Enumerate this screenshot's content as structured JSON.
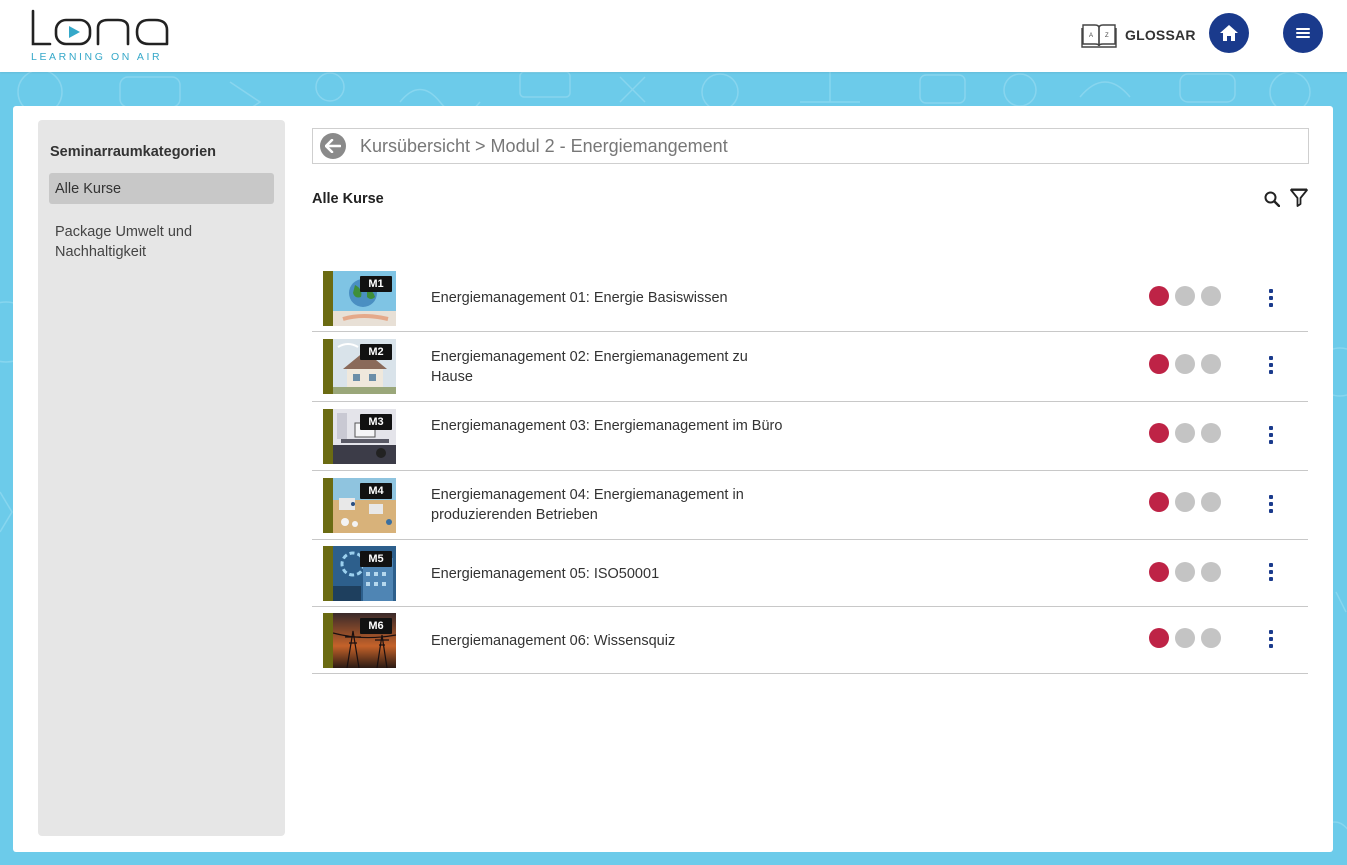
{
  "header": {
    "logo_text": "lona",
    "logo_subtitle": "LEARNING ON AIR",
    "glossar_label": "GLOSSAR",
    "glossar_icon": "book-az-icon",
    "home_icon": "home-icon",
    "menu_icon": "hamburger-menu-icon"
  },
  "colors": {
    "accent": "#1a3a8c",
    "background": "#6ccbea",
    "status_done": "#be2346",
    "status_open": "#c4c4c4",
    "thumb_bar": "#6b6b12"
  },
  "sidebar": {
    "title": "Seminarraumkategorien",
    "items": [
      {
        "label": "Alle Kurse",
        "active": true
      },
      {
        "label": "Package Umwelt und Nachhaltigkeit",
        "active": false
      }
    ]
  },
  "breadcrumb": {
    "text": "Kursübersicht > Modul 2 - Energiemangement"
  },
  "main": {
    "section_title": "Alle Kurse",
    "courses": [
      {
        "badge": "M1",
        "title": "Energiemanagement 01: Energie Basiswissen",
        "status": [
          "done",
          "open",
          "open"
        ]
      },
      {
        "badge": "M2",
        "title": "Energiemanagement 02: Energiemanagement zu Hause",
        "status": [
          "done",
          "open",
          "open"
        ]
      },
      {
        "badge": "M3",
        "title": "Energiemanagement 03: Energiemanagement im Büro",
        "status": [
          "done",
          "open",
          "open"
        ]
      },
      {
        "badge": "M4",
        "title": "Energiemanagement 04: Energiemanagement in produzierenden Betrieben",
        "status": [
          "done",
          "open",
          "open"
        ]
      },
      {
        "badge": "M5",
        "title": "Energiemanagement 05: ISO50001",
        "status": [
          "done",
          "open",
          "open"
        ]
      },
      {
        "badge": "M6",
        "title": "Energiemanagement 06: Wissensquiz",
        "status": [
          "done",
          "open",
          "open"
        ]
      }
    ]
  }
}
